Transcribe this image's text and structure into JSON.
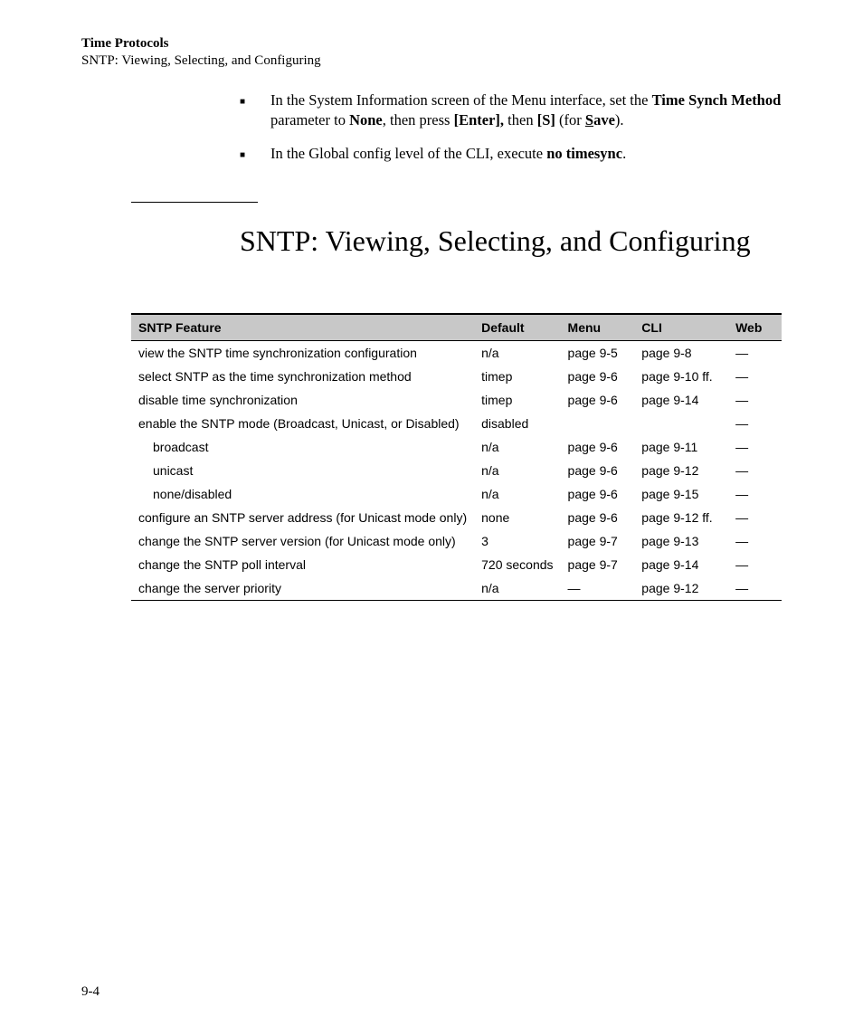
{
  "header": {
    "title": "Time Protocols",
    "subtitle": "SNTP: Viewing, Selecting, and Configuring"
  },
  "bullets": {
    "b1_pre": "In the System Information screen of the Menu interface, set the ",
    "b1_bold1": "Time Synch Method",
    "b1_mid1": " parameter to ",
    "b1_bold2": "None",
    "b1_mid2": ", then press ",
    "b1_bold3": "[Enter],",
    "b1_mid3": " then ",
    "b1_bold4a": "[S]",
    "b1_mid4": " (for ",
    "b1_bold5u": "S",
    "b1_bold5r": "ave",
    "b1_end": ").",
    "b2_pre": "In the Global config level of the CLI, execute ",
    "b2_bold": "no timesync",
    "b2_end": "."
  },
  "section_heading": "SNTP: Viewing, Selecting, and Configuring",
  "table": {
    "headers": {
      "feature": "SNTP Feature",
      "default": "Default",
      "menu": "Menu",
      "cli": "CLI",
      "web": "Web"
    },
    "rows": [
      {
        "feature": "view the SNTP time synchronization configuration",
        "default": "n/a",
        "menu": "page 9-5",
        "cli": "page 9-8",
        "web": "—",
        "indent": false
      },
      {
        "feature": "select SNTP as the time synchronization method",
        "default": "timep",
        "menu": "page 9-6",
        "cli": "page 9-10 ff.",
        "web": "—",
        "indent": false
      },
      {
        "feature": "disable time synchronization",
        "default": "timep",
        "menu": "page 9-6",
        "cli": "page 9-14",
        "web": "—",
        "indent": false
      },
      {
        "feature": "enable the SNTP mode (Broadcast, Unicast, or Disabled)",
        "default": "disabled",
        "menu": "",
        "cli": "",
        "web": "—",
        "indent": false
      },
      {
        "feature": "broadcast",
        "default": "n/a",
        "menu": "page 9-6",
        "cli": "page 9-11",
        "web": "—",
        "indent": true
      },
      {
        "feature": "unicast",
        "default": "n/a",
        "menu": "page 9-6",
        "cli": "page 9-12",
        "web": "—",
        "indent": true
      },
      {
        "feature": "none/disabled",
        "default": "n/a",
        "menu": "page 9-6",
        "cli": "page 9-15",
        "web": "—",
        "indent": true
      },
      {
        "feature": "configure an SNTP server address (for Unicast mode only)",
        "default": "none",
        "menu": "page 9-6",
        "cli": "page 9-12 ff.",
        "web": "—",
        "indent": false
      },
      {
        "feature": "change the SNTP server version (for Unicast mode only)",
        "default": "3",
        "menu": "page 9-7",
        "cli": "page 9-13",
        "web": "—",
        "indent": false
      },
      {
        "feature": "change the SNTP poll interval",
        "default": "720 seconds",
        "menu": "page 9-7",
        "cli": "page 9-14",
        "web": "—",
        "indent": false
      },
      {
        "feature": "change the server priority",
        "default": "n/a",
        "menu": "—",
        "cli": "page 9-12",
        "web": "—",
        "indent": false
      }
    ]
  },
  "page_number": "9-4"
}
